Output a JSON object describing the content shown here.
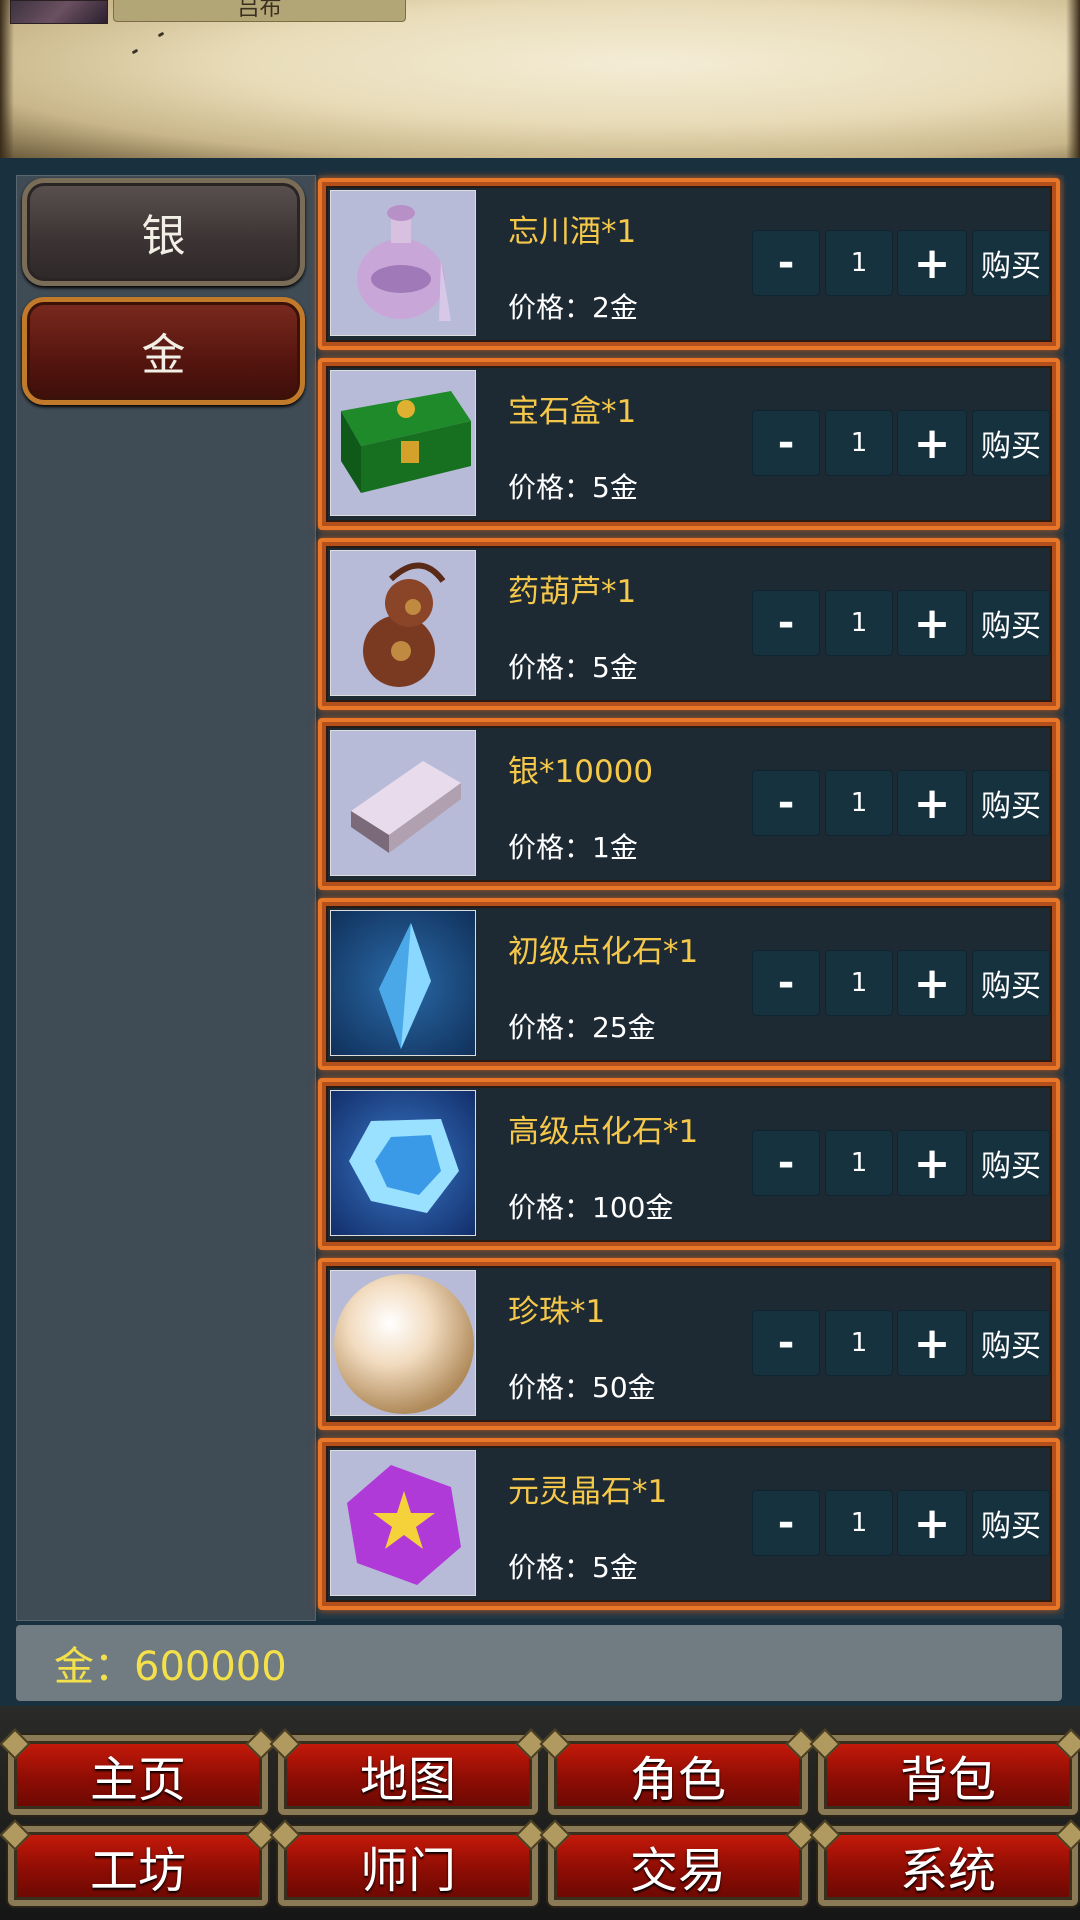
{
  "header": {
    "player_name": "吕布"
  },
  "categories": [
    {
      "label": "银",
      "selected": false
    },
    {
      "label": "金",
      "selected": true
    }
  ],
  "items": [
    {
      "name": "忘川酒*1",
      "price": "价格：2金",
      "qty": "1",
      "icon": "wine-jar-icon"
    },
    {
      "name": "宝石盒*1",
      "price": "价格：5金",
      "qty": "1",
      "icon": "gem-chest-icon"
    },
    {
      "name": "药葫芦*1",
      "price": "价格：5金",
      "qty": "1",
      "icon": "medicine-gourd-icon"
    },
    {
      "name": "银*10000",
      "price": "价格：1金",
      "qty": "1",
      "icon": "silver-ingot-icon"
    },
    {
      "name": "初级点化石*1",
      "price": "价格：25金",
      "qty": "1",
      "icon": "blue-crystal-icon"
    },
    {
      "name": "高级点化石*1",
      "price": "价格：100金",
      "qty": "1",
      "icon": "ice-crystal-icon"
    },
    {
      "name": "珍珠*1",
      "price": "价格：50金",
      "qty": "1",
      "icon": "pearl-icon"
    },
    {
      "name": "元灵晶石*1",
      "price": "价格：5金",
      "qty": "1",
      "icon": "purple-star-gem-icon"
    }
  ],
  "controls": {
    "minus": "-",
    "plus": "+",
    "buy": "购买"
  },
  "balance": "金：600000",
  "nav": [
    "主页",
    "地图",
    "角色",
    "背包",
    "工坊",
    "师门",
    "交易",
    "系统"
  ],
  "colors": {
    "item_name": "#f5c84a",
    "balance": "#f3e04a",
    "item_border": "#e8772a",
    "nav_button": "#a8120a"
  }
}
